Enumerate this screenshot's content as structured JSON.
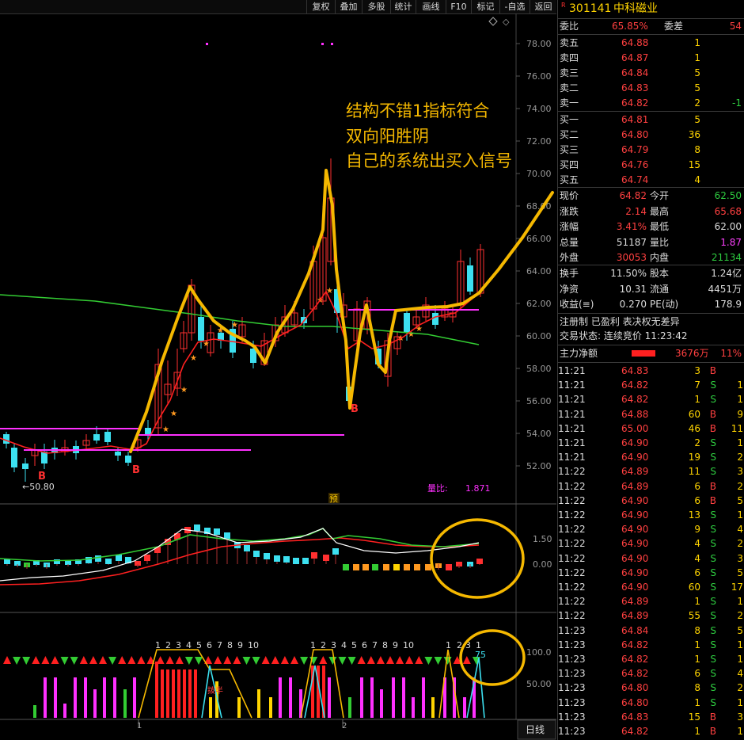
{
  "toolbar": {
    "buttons": [
      "复权",
      "叠加",
      "多股",
      "统计",
      "画线",
      "F10",
      "标记",
      "-自选",
      "返回"
    ]
  },
  "chart": {
    "price_axis": [
      "78.00",
      "76.00",
      "74.00",
      "72.00",
      "70.00",
      "68.00",
      "66.00",
      "64.00",
      "62.00",
      "60.00",
      "58.00",
      "56.00",
      "54.00",
      "52.00"
    ],
    "low_label": "←50.80",
    "volume_ratio_label": "量比:",
    "volume_ratio_value": "1.871",
    "pre_marker": "预",
    "buy_marker": "B",
    "macd_axis": [
      "1.50",
      "0.00"
    ],
    "count_axis": [
      "100.0",
      "50.00"
    ],
    "bottom_labels": [
      "1",
      "2"
    ],
    "period_button": "日线",
    "count_labels_1": [
      "1",
      "2",
      "3",
      "4",
      "5",
      "6",
      "7",
      "8",
      "9",
      "10"
    ],
    "count_labels_2": [
      "1",
      "2",
      "3",
      "4",
      "5",
      "6",
      "7",
      "8",
      "9",
      "10"
    ],
    "count_labels_3": [
      "1",
      "2",
      "3",
      "1"
    ],
    "count_value": "75",
    "small_label": "拨半"
  },
  "annotation": {
    "line1": "结构不错1指标符合",
    "line2": "双向阳胜阴",
    "line3": "自己的系统出买入信号"
  },
  "stock": {
    "flag": "R",
    "code": "301141",
    "name": "中科磁业"
  },
  "ratio": {
    "label1": "委比",
    "value1": "65.85%",
    "label2": "委差",
    "value2": "54"
  },
  "asks": [
    {
      "label": "卖五",
      "price": "64.88",
      "vol": "1",
      "chg": ""
    },
    {
      "label": "卖四",
      "price": "64.87",
      "vol": "1",
      "chg": ""
    },
    {
      "label": "卖三",
      "price": "64.84",
      "vol": "5",
      "chg": ""
    },
    {
      "label": "卖二",
      "price": "64.83",
      "vol": "5",
      "chg": ""
    },
    {
      "label": "卖一",
      "price": "64.82",
      "vol": "2",
      "chg": "-1"
    }
  ],
  "bids": [
    {
      "label": "买一",
      "price": "64.81",
      "vol": "5"
    },
    {
      "label": "买二",
      "price": "64.80",
      "vol": "36"
    },
    {
      "label": "买三",
      "price": "64.79",
      "vol": "8"
    },
    {
      "label": "买四",
      "price": "64.76",
      "vol": "15"
    },
    {
      "label": "买五",
      "price": "64.74",
      "vol": "4"
    }
  ],
  "quote": [
    {
      "l1": "现价",
      "v1": "64.82",
      "c1": "red",
      "l2": "今开",
      "v2": "62.50",
      "c2": "green"
    },
    {
      "l1": "涨跌",
      "v1": "2.14",
      "c1": "red",
      "l2": "最高",
      "v2": "65.68",
      "c2": "red"
    },
    {
      "l1": "涨幅",
      "v1": "3.41%",
      "c1": "red",
      "l2": "最低",
      "v2": "62.00",
      "c2": "white"
    },
    {
      "l1": "总量",
      "v1": "51187",
      "c1": "white",
      "l2": "量比",
      "v2": "1.87",
      "c2": "magenta"
    },
    {
      "l1": "外盘",
      "v1": "30053",
      "c1": "red",
      "l2": "内盘",
      "v2": "21134",
      "c2": "green"
    }
  ],
  "fundamentals": [
    {
      "l1": "换手",
      "v1": "11.50%",
      "l2": "股本",
      "v2": "1.24亿"
    },
    {
      "l1": "净资",
      "v1": "10.31",
      "l2": "流通",
      "v2": "4451万"
    },
    {
      "l1": "收益(≡)",
      "v1": "0.270",
      "l2": "PE(动)",
      "v2": "178.9"
    }
  ],
  "status": {
    "tags": "注册制 已盈利 表决权无差异",
    "trading_label": "交易状态: 连续竞价 11:23:42"
  },
  "capital": {
    "label": "主力净额",
    "value": "3676万",
    "pct": "11%"
  },
  "trades": [
    {
      "t": "11:21",
      "p": "64.83",
      "v": "3",
      "d": "B",
      "n": ""
    },
    {
      "t": "11:21",
      "p": "64.82",
      "v": "7",
      "d": "S",
      "n": "1"
    },
    {
      "t": "11:21",
      "p": "64.82",
      "v": "1",
      "d": "S",
      "n": "1"
    },
    {
      "t": "11:21",
      "p": "64.88",
      "v": "60",
      "d": "B",
      "n": "9"
    },
    {
      "t": "11:21",
      "p": "65.00",
      "v": "46",
      "d": "B",
      "n": "11"
    },
    {
      "t": "11:21",
      "p": "64.90",
      "v": "2",
      "d": "S",
      "n": "1"
    },
    {
      "t": "11:21",
      "p": "64.90",
      "v": "19",
      "d": "S",
      "n": "2"
    },
    {
      "t": "11:22",
      "p": "64.89",
      "v": "11",
      "d": "S",
      "n": "3"
    },
    {
      "t": "11:22",
      "p": "64.89",
      "v": "6",
      "d": "B",
      "n": "2"
    },
    {
      "t": "11:22",
      "p": "64.90",
      "v": "6",
      "d": "B",
      "n": "5"
    },
    {
      "t": "11:22",
      "p": "64.90",
      "v": "13",
      "d": "S",
      "n": "1"
    },
    {
      "t": "11:22",
      "p": "64.90",
      "v": "9",
      "d": "S",
      "n": "4"
    },
    {
      "t": "11:22",
      "p": "64.90",
      "v": "4",
      "d": "S",
      "n": "2"
    },
    {
      "t": "11:22",
      "p": "64.90",
      "v": "4",
      "d": "S",
      "n": "3"
    },
    {
      "t": "11:22",
      "p": "64.90",
      "v": "6",
      "d": "S",
      "n": "5"
    },
    {
      "t": "11:22",
      "p": "64.90",
      "v": "60",
      "d": "S",
      "n": "17"
    },
    {
      "t": "11:22",
      "p": "64.89",
      "v": "1",
      "d": "S",
      "n": "1"
    },
    {
      "t": "11:22",
      "p": "64.89",
      "v": "55",
      "d": "S",
      "n": "2"
    },
    {
      "t": "11:23",
      "p": "64.84",
      "v": "8",
      "d": "S",
      "n": "5"
    },
    {
      "t": "11:23",
      "p": "64.82",
      "v": "1",
      "d": "S",
      "n": "1"
    },
    {
      "t": "11:23",
      "p": "64.82",
      "v": "1",
      "d": "S",
      "n": "1"
    },
    {
      "t": "11:23",
      "p": "64.82",
      "v": "6",
      "d": "S",
      "n": "4"
    },
    {
      "t": "11:23",
      "p": "64.80",
      "v": "8",
      "d": "S",
      "n": "2"
    },
    {
      "t": "11:23",
      "p": "64.80",
      "v": "1",
      "d": "S",
      "n": "1"
    },
    {
      "t": "11:23",
      "p": "64.83",
      "v": "15",
      "d": "B",
      "n": "3"
    },
    {
      "t": "11:23",
      "p": "64.82",
      "v": "1",
      "d": "B",
      "n": "1"
    }
  ],
  "colors": {
    "up": "#ff3030",
    "down": "#3ce0f0",
    "ma_red": "#ff2020",
    "ma_green": "#33cc33",
    "ma_white": "#ffffff",
    "annot": "#f5b800",
    "magenta": "#ff30ff"
  }
}
